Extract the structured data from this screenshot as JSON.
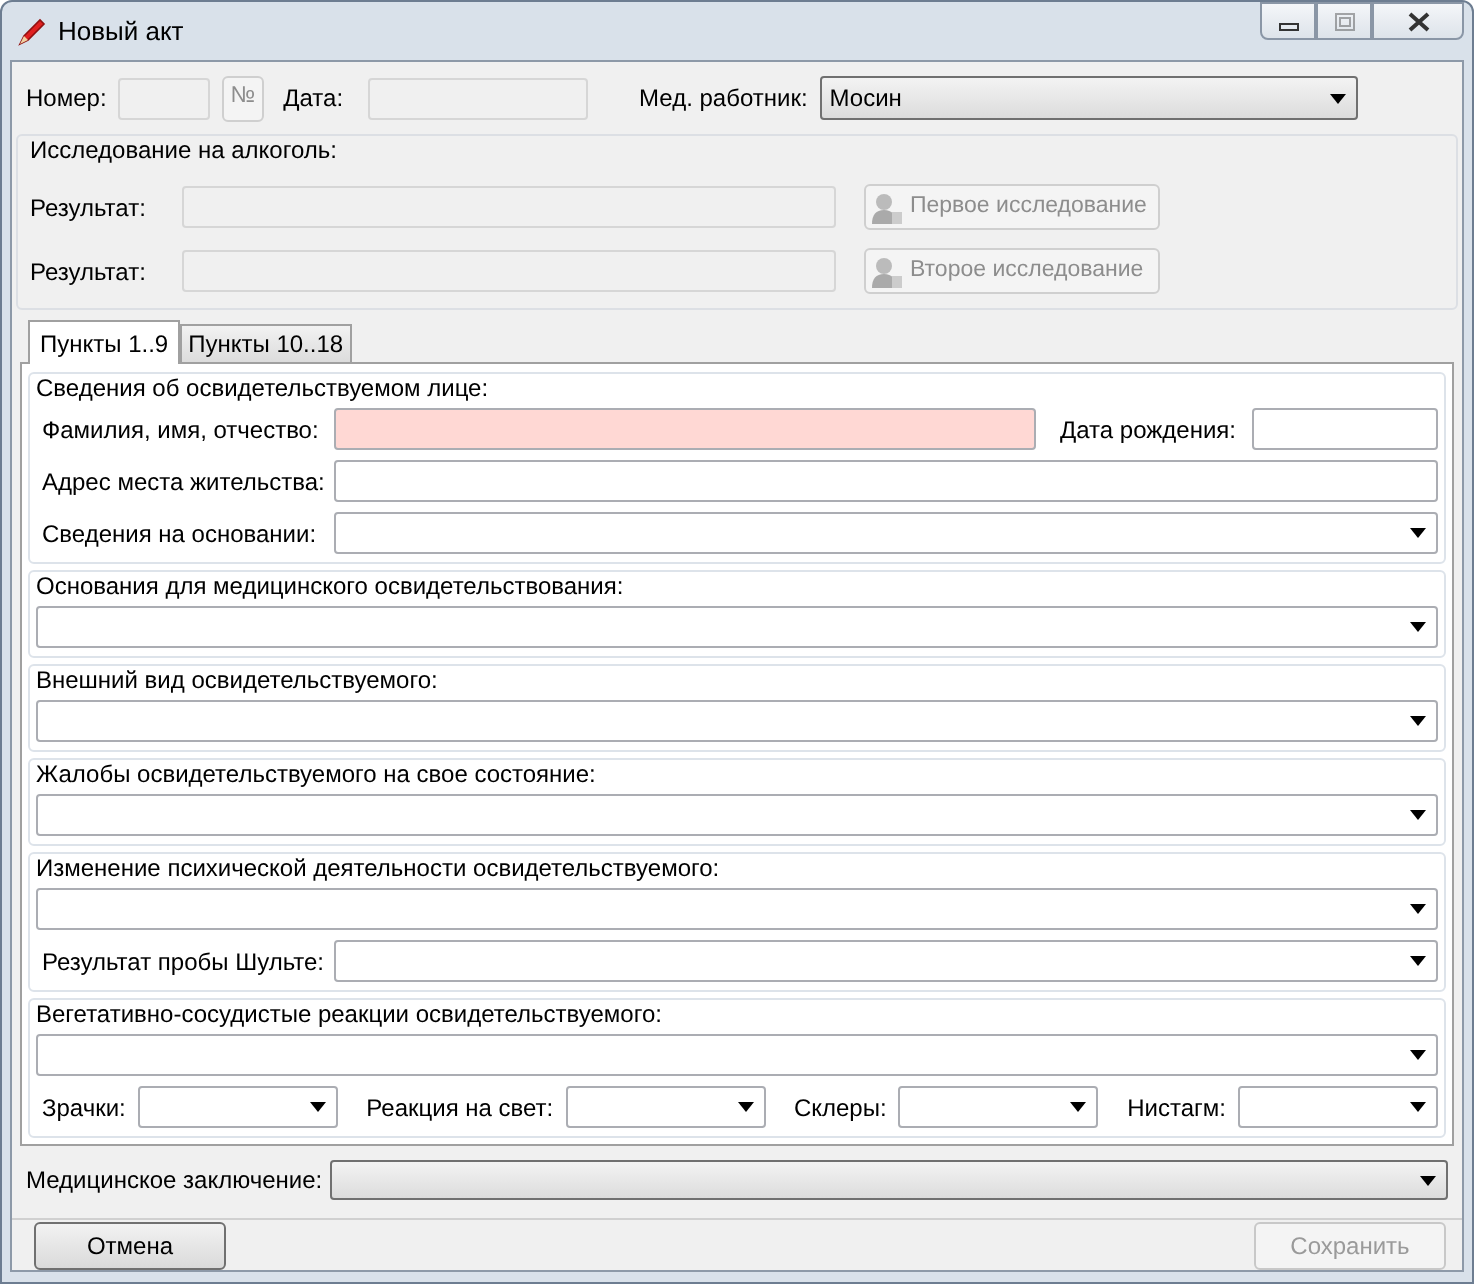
{
  "window": {
    "title": "Новый акт",
    "controls": [
      {
        "kind": "minimize",
        "disabled": false
      },
      {
        "kind": "maximize",
        "disabled": true
      },
      {
        "kind": "close",
        "disabled": false
      }
    ]
  },
  "header": {
    "number": {
      "label": "Номер:",
      "disabled": true
    },
    "number_button": {
      "label": "№",
      "disabled": true
    },
    "date": {
      "label": "Дата:",
      "disabled": true
    },
    "worker": {
      "label": "Мед. работник:",
      "value": "Мосин"
    }
  },
  "alcohol_test": {
    "title": "Исследование на алкоголь:",
    "rows": [
      {
        "label": "Результат:",
        "button": "Первое исследование",
        "disabled": true
      },
      {
        "label": "Результат:",
        "button": "Второе исследование",
        "disabled": true
      }
    ]
  },
  "tabs": [
    {
      "label": "Пункты 1..9",
      "selected": true
    },
    {
      "label": "Пункты 10..18",
      "selected": false
    }
  ],
  "sections": [
    {
      "title": "Сведения об освидетельствуемом лице:",
      "rows": [
        [
          {
            "kind": "text",
            "label": "Фамилия, имя, отчество:",
            "invalid": true
          },
          {
            "kind": "small_text",
            "label": "Дата рождения:",
            "invalid": false
          }
        ],
        [
          {
            "kind": "text",
            "label": "Адрес места жительства:",
            "invalid": false
          }
        ],
        [
          {
            "kind": "combo",
            "label": "Сведения на основании:",
            "invalid": false
          }
        ]
      ]
    },
    {
      "title": "Основания для медицинского освидетельствования:",
      "rows": [
        [
          {
            "kind": "combo",
            "invalid": false
          }
        ]
      ]
    },
    {
      "title": "Внешний вид освидетельствуемого:",
      "rows": [
        [
          {
            "kind": "combo",
            "invalid": false
          }
        ]
      ]
    },
    {
      "title": "Жалобы освидетельствуемого на свое состояние:",
      "rows": [
        [
          {
            "kind": "combo",
            "invalid": false
          }
        ]
      ]
    },
    {
      "title": "Изменение психической деятельности освидетельствуемого:",
      "rows": [
        [
          {
            "kind": "combo",
            "invalid": false
          }
        ],
        [
          {
            "kind": "combo",
            "label": "Результат пробы Шульте:",
            "invalid": false
          }
        ]
      ]
    },
    {
      "title": "Вегетативно-сосудистые реакции освидетельствуемого:",
      "rows": [
        [
          {
            "kind": "combo",
            "invalid": false
          }
        ],
        [
          {
            "kind": "small_combo",
            "label": "Зрачки:",
            "invalid": false
          },
          {
            "kind": "small_combo",
            "label": "Реакция на свет:",
            "invalid": false
          },
          {
            "kind": "small_combo",
            "label": "Склеры:",
            "invalid": false
          },
          {
            "kind": "small_combo",
            "label": "Нистагм:",
            "invalid": false
          }
        ]
      ]
    }
  ],
  "conclusion": {
    "label": "Медицинское заключение:"
  },
  "footer": {
    "cancel": {
      "label": "Отмена",
      "disabled": false
    },
    "save": {
      "label": "Сохранить",
      "disabled": true
    }
  }
}
